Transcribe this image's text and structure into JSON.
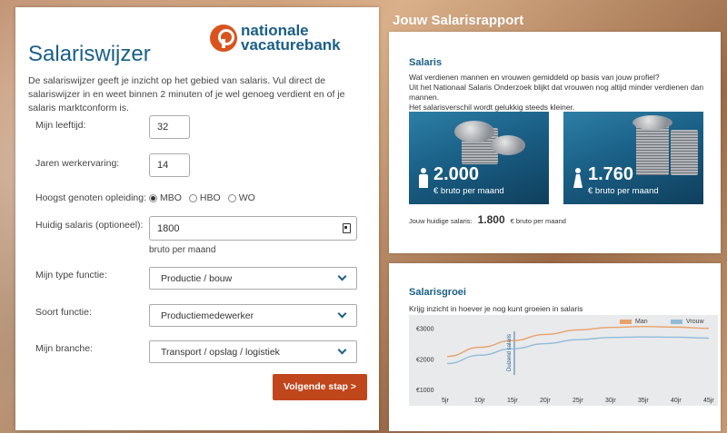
{
  "form": {
    "title": "Salariswijzer",
    "logo_line1": "nationale",
    "logo_line2": "vacaturebank",
    "intro": "De salariswijzer geeft je inzicht op het gebied van salaris. Vul direct de salariswijzer in en weet binnen 2 minuten of je wel genoeg verdient en of je salaris marktconform is.",
    "age_label": "Mijn leeftijd:",
    "age_value": "32",
    "experience_label": "Jaren werkervaring:",
    "experience_value": "14",
    "education_label": "Hoogst genoten opleiding:",
    "education_options": [
      "MBO",
      "HBO",
      "WO"
    ],
    "education_selected": "MBO",
    "salary_label": "Huidig salaris (optioneel):",
    "salary_value": "1800",
    "salary_hint": "bruto per maand",
    "function_type_label": "Mijn type functie:",
    "function_type_value": "Productie / bouw",
    "function_kind_label": "Soort functie:",
    "function_kind_value": "Productiemedewerker",
    "branch_label": "Mijn branche:",
    "branch_value": "Transport / opslag / logistiek",
    "next_button": "Volgende stap >"
  },
  "report": {
    "title": "Jouw Salarisrapport",
    "salary_card": {
      "heading": "Salaris",
      "line1": "Wat verdienen mannen en vrouwen gemiddeld op basis van jouw profiel?",
      "line2": "Uit het Nationaal Salaris Onderzoek blijkt dat vrouwen nog altijd minder verdienen dan mannen.",
      "line3": "Het salarisverschil wordt gelukkig steeds kleiner.",
      "male_amount": "2.000",
      "female_amount": "1.760",
      "per_month": "€ bruto per maand",
      "current_label": "Jouw huidige salaris:",
      "current_amount": "1.800",
      "current_suffix": "€ bruto per maand"
    },
    "growth_card": {
      "heading": "Salarisgroei",
      "subtitle": "Krijg inzicht in hoever je nog kunt groeien in salaris",
      "marker_label": "Duizend salaris"
    }
  },
  "colors": {
    "brand_blue": "#1a5f86",
    "brand_orange": "#c0461c",
    "man": "#e8a26a",
    "vrouw": "#8fbcd8"
  },
  "chart_data": {
    "type": "line",
    "x": [
      "5jr",
      "10jr",
      "15jr",
      "20jr",
      "25jr",
      "30jr",
      "35jr",
      "40jr",
      "45jr"
    ],
    "series": [
      {
        "name": "Man",
        "values": [
          2080,
          2380,
          2600,
          2800,
          2950,
          3030,
          3060,
          3040,
          3000
        ]
      },
      {
        "name": "Vrouw",
        "values": [
          1850,
          2120,
          2330,
          2500,
          2630,
          2700,
          2720,
          2710,
          2680
        ]
      }
    ],
    "ytick_labels": [
      "€3000",
      "€2000",
      "€1000"
    ],
    "ylim": [
      1000,
      3200
    ],
    "legend": "top-right"
  }
}
